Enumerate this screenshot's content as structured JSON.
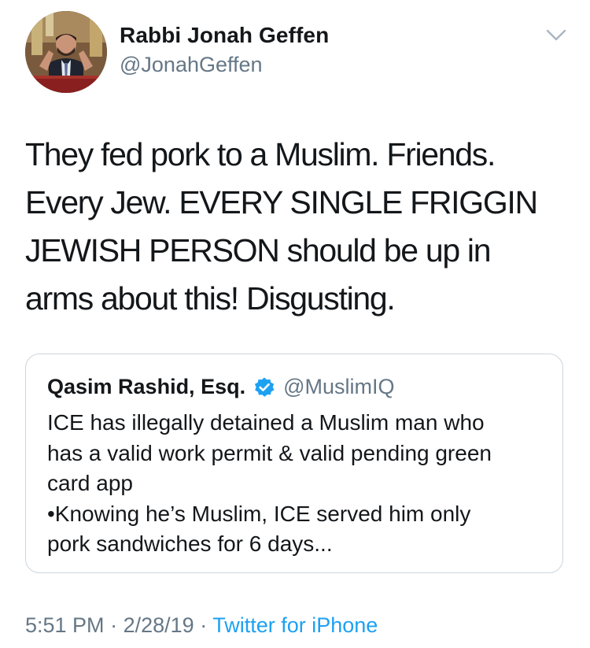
{
  "author": {
    "name": "Rabbi Jonah Geffen",
    "handle": "@JonahGeffen"
  },
  "tweet": {
    "text": "They fed pork to a Muslim. Friends.\nEvery Jew. EVERY SINGLE FRIGGIN\nJEWISH PERSON should be up in\narms about this! Disgusting."
  },
  "quoted_tweet": {
    "name": "Qasim Rashid, Esq.",
    "handle": "@MuslimIQ",
    "verified": true,
    "text": "ICE has illegally detained a Muslim man who\nhas a valid work permit & valid pending green\ncard app\n•Knowing he’s Muslim, ICE served him only\npork sandwiches for 6 days..."
  },
  "meta": {
    "time": "5:51 PM",
    "date": "2/28/19",
    "separator": "·",
    "source": "Twitter for iPhone"
  },
  "icons": {
    "menu": "chevron-down-icon",
    "verified": "verified-badge-icon"
  },
  "colors": {
    "text": "#14171a",
    "secondary": "#657786",
    "link": "#1da1f2",
    "border": "#ccd6dd",
    "verified": "#1da1f2"
  }
}
